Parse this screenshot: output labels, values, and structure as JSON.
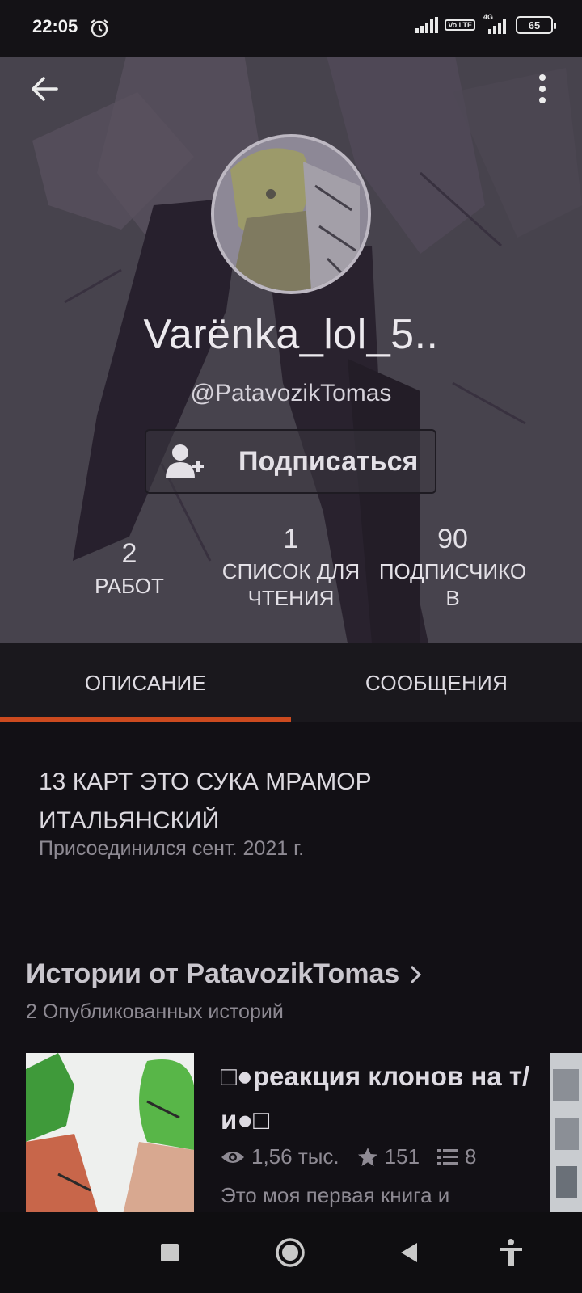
{
  "status_bar": {
    "time": "22:05",
    "network": "4G",
    "volte": "Vo LTE",
    "battery": "65",
    "icons": [
      "alarm-icon",
      "signal-icon",
      "volte-icon",
      "signal-4g-icon",
      "battery-icon"
    ]
  },
  "header": {
    "back_icon": "arrow-left-icon",
    "more_icon": "more-vertical-icon"
  },
  "profile": {
    "display_name": "Varënka_lol_5..",
    "username": "@PatavozikTomas",
    "follow_label": "Подписаться",
    "follow_icon": "add-user-icon"
  },
  "stats": [
    {
      "value": "2",
      "label": "РАБОТ"
    },
    {
      "value": "1",
      "label": "СПИСОК ДЛЯ ЧТЕНИЯ"
    },
    {
      "value": "90",
      "label": "ПОДПИСЧИКО В"
    }
  ],
  "tabs": [
    {
      "label": "ОПИСАНИЕ",
      "active": true
    },
    {
      "label": "СООБЩЕНИЯ",
      "active": false
    }
  ],
  "about": {
    "description": "13 КАРТ ЭТО СУКА МРАМОР ИТАЛЬЯНСКИЙ",
    "joined": "Присоединился сент. 2021 г."
  },
  "stories": {
    "title": "Истории от PatavozikTomas",
    "subtitle": "2 Опубликованных историй",
    "items": [
      {
        "title": "□●реакция клонов на т/и●□",
        "views": "1,56 тыс.",
        "votes": "151",
        "parts": "8",
        "blurb": "Это моя первая книга и"
      }
    ]
  },
  "navbar": {
    "icons": [
      "recents-square-icon",
      "home-circle-icon",
      "back-triangle-icon",
      "accessibility-icon"
    ]
  },
  "colors": {
    "accent": "#cc4a1f",
    "background": "#121015",
    "tab_bar": "#1a181d",
    "muted_text": "#8e8a93"
  }
}
